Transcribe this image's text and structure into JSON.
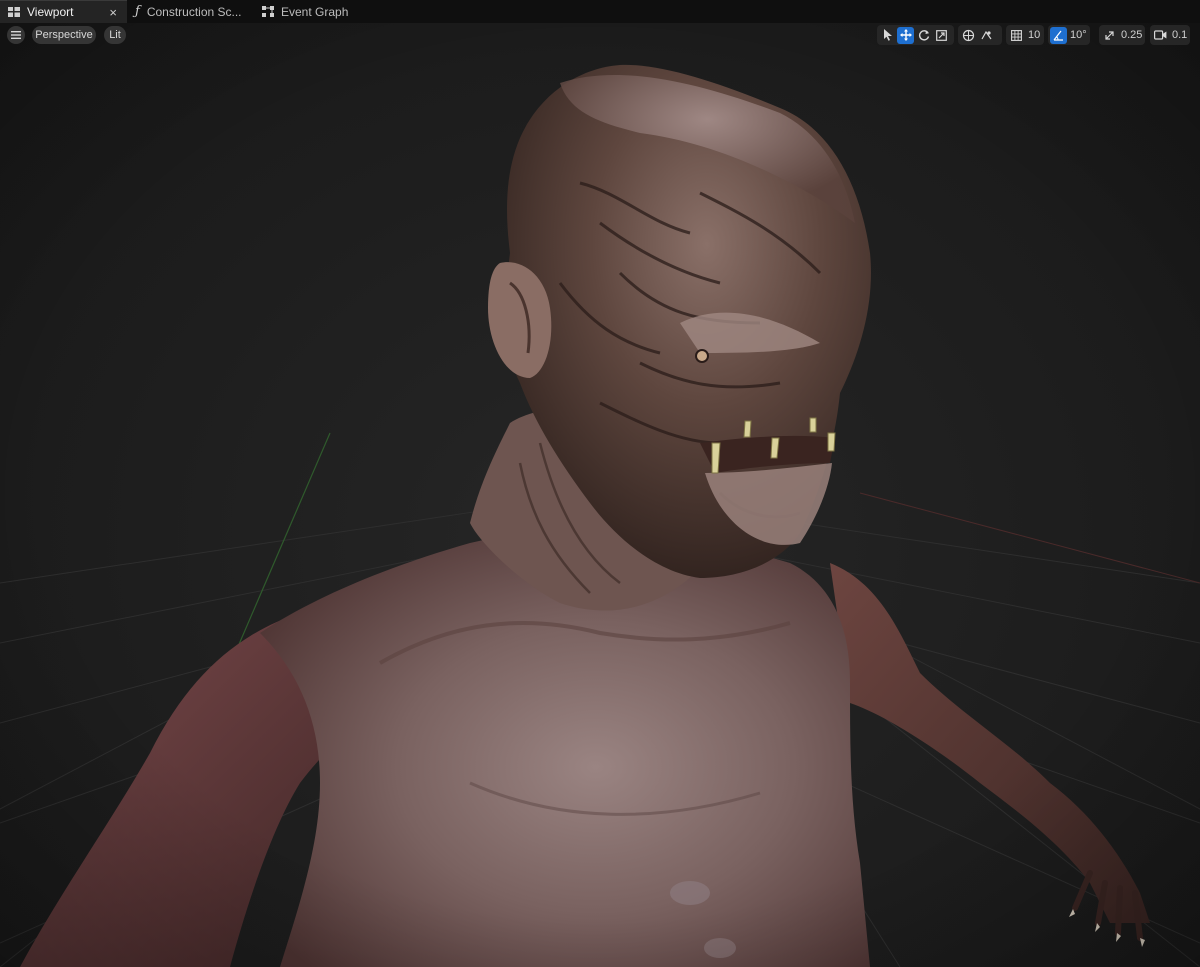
{
  "tabs": [
    {
      "label": "Viewport",
      "icon": "viewport-grid-icon",
      "active": true,
      "close": "×"
    },
    {
      "label": "Construction Sc...",
      "icon": "function-icon",
      "glyph": "ƒ"
    },
    {
      "label": "Event Graph",
      "icon": "event-graph-icon"
    }
  ],
  "toolbar": {
    "menu_icon": "hamburger-menu-icon",
    "view_mode": "Perspective",
    "lighting": "Lit",
    "tools": {
      "select": "select-arrow-icon",
      "translate": "translate-icon",
      "rotate": "rotate-icon",
      "scale": "scale-icon",
      "world_local": "world-coordinate-icon",
      "surface_snap": "surface-snapping-icon"
    },
    "grid_snap": "10",
    "rotation_snap": "10°",
    "scale_snap": "0.25",
    "camera_speed": "0.1",
    "accent_color": "#1e6fd0"
  },
  "scene": {
    "background": "#1d1d1d",
    "subject": "creature-bust"
  }
}
